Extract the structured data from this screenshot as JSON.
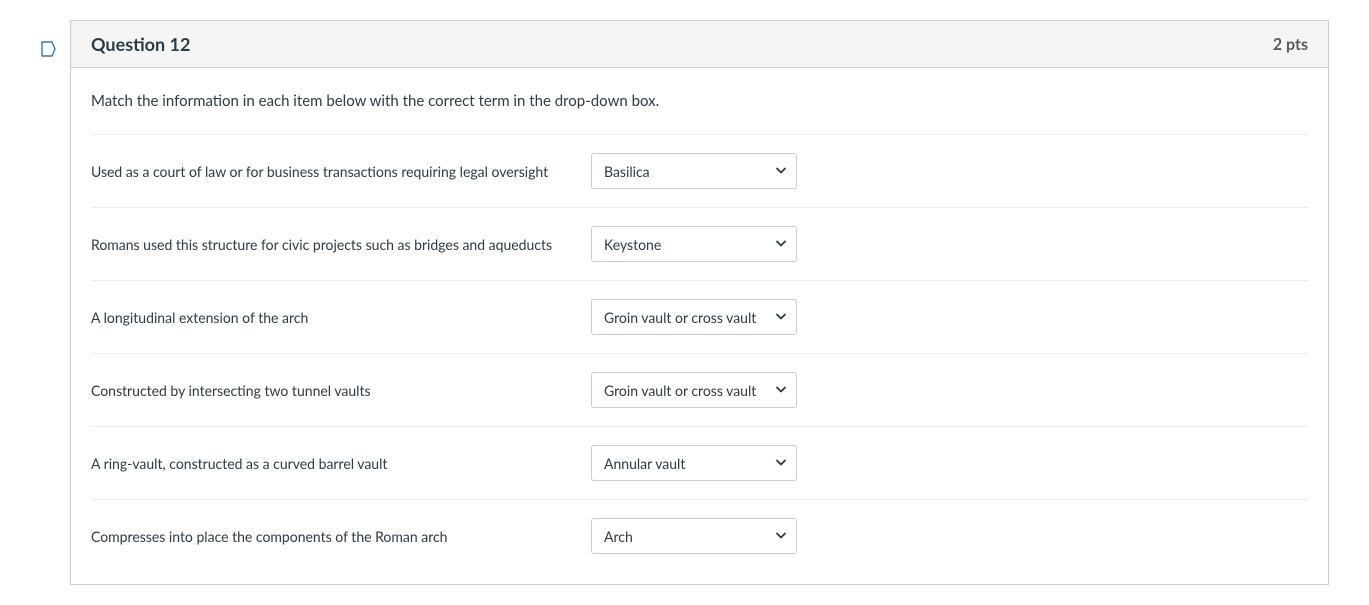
{
  "question": {
    "title": "Question 12",
    "points": "2 pts",
    "instructions": "Match the information in each item below with the correct term in the drop-down box.",
    "items": [
      {
        "prompt": "Used as a court of law or for business transactions requiring legal oversight",
        "selected": "Basilica"
      },
      {
        "prompt": "Romans used this structure for civic projects such as bridges and aqueducts",
        "selected": "Keystone"
      },
      {
        "prompt": "A longitudinal extension of the arch",
        "selected": "Groin vault or cross vault"
      },
      {
        "prompt": "Constructed by intersecting two tunnel vaults",
        "selected": "Groin vault or cross vault"
      },
      {
        "prompt": "A ring-vault, constructed as a curved barrel vault",
        "selected": "Annular vault"
      },
      {
        "prompt": "Compresses into place the components of the Roman arch",
        "selected": "Arch"
      }
    ]
  }
}
